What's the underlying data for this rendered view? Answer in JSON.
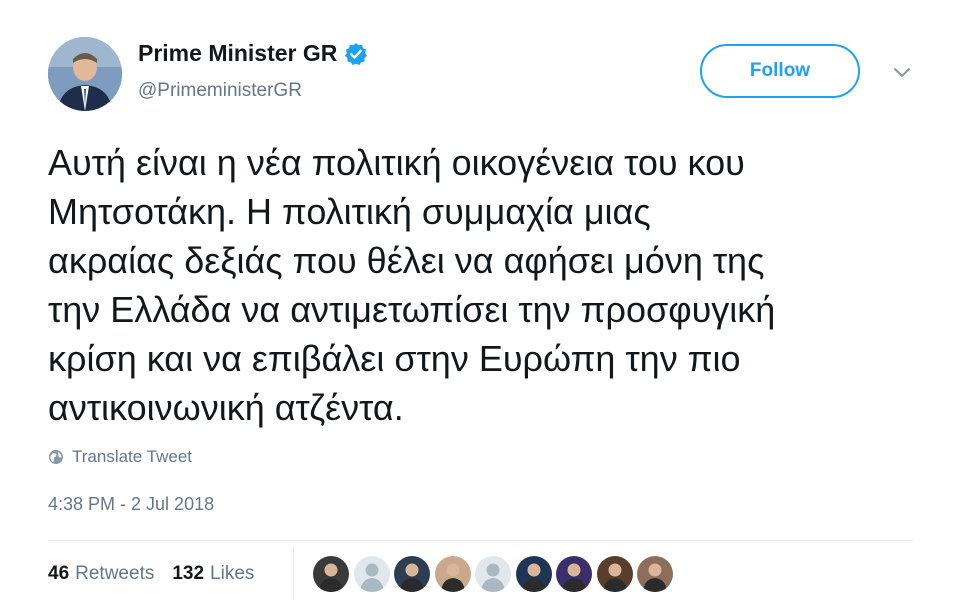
{
  "author": {
    "display_name": "Prime Minister GR",
    "handle": "@PrimeministerGR",
    "verified": true,
    "avatar_icon": "person-avatar-icon"
  },
  "header": {
    "follow_label": "Follow",
    "menu_icon": "chevron-down-icon"
  },
  "tweet": {
    "lines": [
      "Αυτή είναι η νέα πολιτική οικογένεια του κου",
      "Μητσοτάκη. Η πολιτική συμμαχία μιας",
      "ακραίας δεξιάς που θέλει να αφήσει μόνη της",
      "την Ελλάδα να αντιμετωπίσει την προσφυγική",
      "κρίση και να επιβάλει στην Ευρώπη την πιο",
      "αντικοινωνική ατζέντα."
    ]
  },
  "translate": {
    "label": "Translate Tweet",
    "icon": "globe-icon"
  },
  "timestamp": "4:38 PM - 2 Jul 2018",
  "stats": {
    "retweets_count": "46",
    "retweets_label": "Retweets",
    "likes_count": "132",
    "likes_label": "Likes"
  },
  "likers": [
    {
      "icon": "liker-avatar-icon",
      "color": "#3a3a3a"
    },
    {
      "icon": "default-avatar-icon",
      "color": "#aab8c2"
    },
    {
      "icon": "liker-avatar-icon",
      "color": "#2c3e50"
    },
    {
      "icon": "liker-avatar-icon",
      "color": "#c9a98a"
    },
    {
      "icon": "default-avatar-icon",
      "color": "#aab8c2"
    },
    {
      "icon": "liker-avatar-icon",
      "color": "#1f3556"
    },
    {
      "icon": "liker-avatar-icon",
      "color": "#3b2f6b"
    },
    {
      "icon": "liker-avatar-icon",
      "color": "#5a3d2b"
    },
    {
      "icon": "liker-avatar-icon",
      "color": "#8c6e5a"
    }
  ],
  "colors": {
    "accent": "#1da1f2",
    "secondary_text": "#657786",
    "primary_text": "#14171a",
    "divider": "#e6ecf0"
  }
}
